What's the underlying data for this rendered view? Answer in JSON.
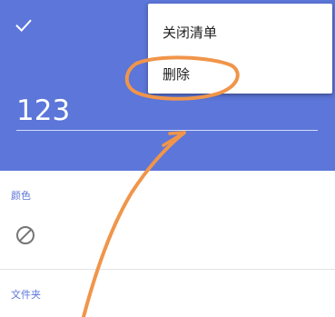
{
  "header": {
    "background_color": "#5c76d9",
    "check_icon": "check-icon",
    "title_value": "123"
  },
  "menu": {
    "items": [
      {
        "label": "关闭清单"
      },
      {
        "label": "删除"
      }
    ]
  },
  "sections": {
    "color_label": "颜色",
    "no_color_icon": "block-icon",
    "folder_label": "文件夹"
  },
  "annotation": {
    "color": "#f0954a"
  }
}
